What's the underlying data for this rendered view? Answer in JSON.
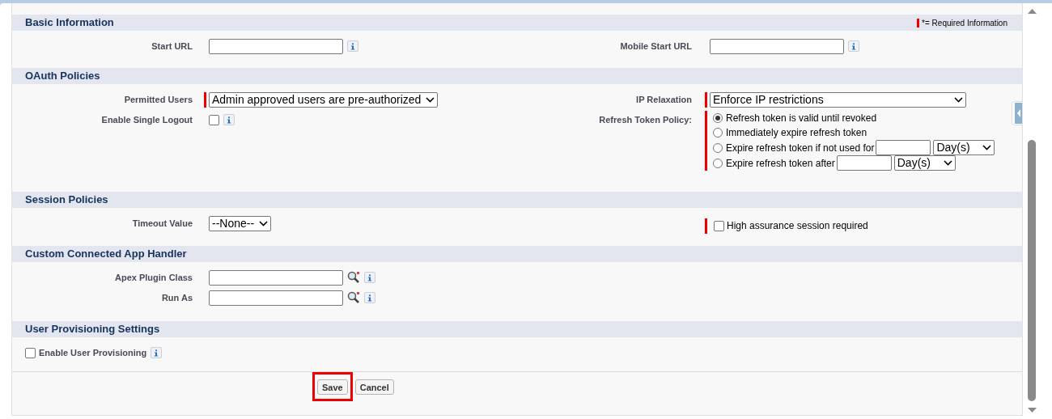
{
  "legend": {
    "text": "*= Required Information"
  },
  "sections": [
    {
      "title": "Basic Information",
      "left": [
        {
          "kind": "text",
          "label": "Start URL",
          "info": true,
          "lookup": false
        }
      ],
      "right": [
        {
          "kind": "text",
          "label": "Mobile Start URL",
          "info": true,
          "lookup": false
        }
      ]
    },
    {
      "title": "OAuth Policies",
      "left": [
        {
          "kind": "select",
          "label": "Permitted Users",
          "value": "Admin approved users are pre-authorized",
          "required": true
        },
        {
          "kind": "checkbox",
          "label": "Enable Single Logout",
          "checked": false,
          "info": true
        }
      ],
      "right": [
        {
          "kind": "select",
          "label": "IP Relaxation",
          "value": "Enforce IP restrictions",
          "required": true
        },
        {
          "kind": "radio-group",
          "label": "Refresh Token Policy:",
          "required": true,
          "options": [
            {
              "text": "Refresh token is valid until revoked",
              "selected": true
            },
            {
              "text": "Immediately expire refresh token",
              "selected": false
            },
            {
              "text": "Expire refresh token if not used for",
              "selected": false,
              "unit": "Day(s)"
            },
            {
              "text": "Expire refresh token after",
              "selected": false,
              "unit": "Day(s)"
            }
          ]
        }
      ]
    },
    {
      "title": "Session Policies",
      "left": [
        {
          "kind": "select",
          "label": "Timeout Value",
          "value": "--None--",
          "required": false
        }
      ],
      "right": [
        {
          "kind": "inline-checkbox",
          "text": "High assurance session required",
          "checked": false,
          "required": true
        }
      ]
    },
    {
      "title": "Custom Connected App Handler",
      "left": [
        {
          "kind": "text",
          "label": "Apex Plugin Class",
          "info": true,
          "lookup": true
        },
        {
          "kind": "text",
          "label": "Run As",
          "info": true,
          "lookup": true
        }
      ]
    },
    {
      "title": "User Provisioning Settings",
      "full": [
        {
          "kind": "checkbox-labeled",
          "text": "Enable User Provisioning",
          "checked": false,
          "info": true
        }
      ]
    }
  ],
  "buttons": [
    {
      "label": "Save",
      "highlighted": true
    },
    {
      "label": "Cancel",
      "highlighted": false
    }
  ]
}
